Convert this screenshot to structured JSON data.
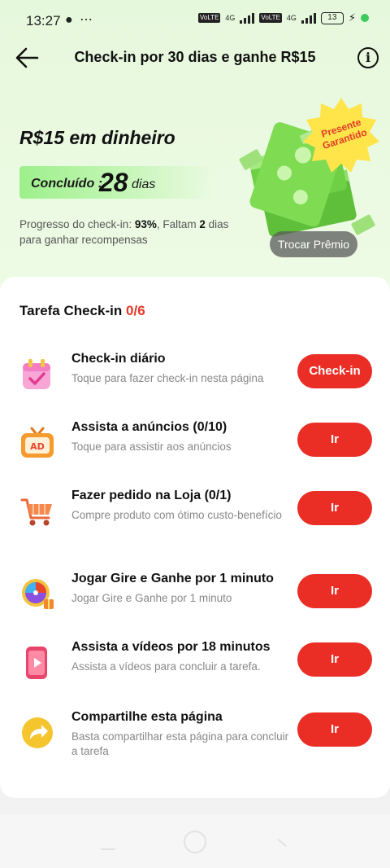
{
  "status": {
    "time": "13:27",
    "left_icons": "● ⋯",
    "network_a": "4G",
    "network_b": "4G",
    "volte": "VoLTE",
    "battery": "13"
  },
  "header": {
    "title": "Check-in por 30 dias e ganhe R$15",
    "info": "i"
  },
  "hero": {
    "title": "R$15 em dinheiro",
    "completed_label": "Concluído :",
    "completed_days": "28",
    "completed_unit": "dias",
    "progress_prefix": "Progresso do check-in: ",
    "progress_percent": "93%",
    "progress_middle": ", Faltam ",
    "days_left": "2",
    "progress_suffix": " dias para ganhar recompensas",
    "badge_text": "Presente Garantido",
    "trade_button": "Trocar Prêmio"
  },
  "tasks_card": {
    "title": "Tarefa Check-in ",
    "count": "0/6",
    "tasks": [
      {
        "icon": "calendar-check-icon",
        "title": "Check-in diário",
        "subtitle": "Toque para fazer check-in nesta página",
        "button": "Check-in"
      },
      {
        "icon": "ad-tv-icon",
        "title": "Assista a anúncios  (0/10)",
        "subtitle": "Toque para assistir aos anúncios",
        "button": "Ir"
      },
      {
        "icon": "shopping-cart-icon",
        "title": "Fazer pedido na Loja  (0/1)",
        "subtitle": "Compre produto com ótimo custo-benefício",
        "button": "Ir"
      },
      {
        "icon": "prize-wheel-icon",
        "title": "Jogar Gire e Ganhe por 1 minuto",
        "subtitle": "Jogar Gire e Ganhe por 1 minuto",
        "button": "Ir"
      },
      {
        "icon": "video-phone-icon",
        "title": "Assista a vídeos por 18 minutos",
        "subtitle": "Assista a vídeos para concluir a tarefa.",
        "button": "Ir"
      },
      {
        "icon": "share-arrow-icon",
        "title": "Compartilhe esta página",
        "subtitle": "Basta compartilhar esta página para concluir a tarefa",
        "button": "Ir"
      }
    ]
  },
  "colors": {
    "accent_red": "#ea2e26",
    "progress_green": "#9df08b",
    "background_green": "#e6f8dc"
  }
}
